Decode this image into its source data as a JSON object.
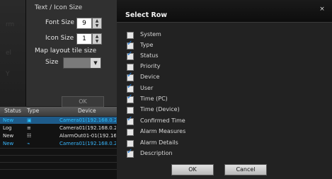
{
  "background": {
    "left_labels": [
      "rm",
      "el",
      "Y"
    ],
    "section_title": "Text / Icon Size",
    "font_size_label": "Font Size",
    "font_size_value": "9",
    "icon_size_label": "Icon Size",
    "icon_size_value": "1",
    "map_layout_label": "Map layout tile size",
    "size_label": "Size",
    "ok_label": "OK",
    "table": {
      "headers": [
        "Status",
        "Type",
        "Device"
      ],
      "rows": [
        {
          "status": "New",
          "type": "▣",
          "device": "Camera01(192.168.0.22"
        },
        {
          "status": "Log",
          "type": "≡",
          "device": "Camera01(192.168.0.22"
        },
        {
          "status": "New",
          "type": "☷",
          "device": "AlarmOut01-01(192.168."
        },
        {
          "status": "New",
          "type": "⌁",
          "device": "Camera01(192.168.0.22"
        }
      ]
    }
  },
  "dialog": {
    "title": "Select Row",
    "close_glyph": "×",
    "items": [
      {
        "label": "System",
        "checked": false
      },
      {
        "label": "Type",
        "checked": true
      },
      {
        "label": "Status",
        "checked": true
      },
      {
        "label": "Priority",
        "checked": false
      },
      {
        "label": "Device",
        "checked": true
      },
      {
        "label": "User",
        "checked": true
      },
      {
        "label": "Time (PC)",
        "checked": true
      },
      {
        "label": "Time (Device)",
        "checked": false
      },
      {
        "label": "Confirmed Time",
        "checked": true
      },
      {
        "label": "Alarm Measures",
        "checked": false
      },
      {
        "label": "Alarm Details",
        "checked": false
      },
      {
        "label": "Description",
        "checked": true
      }
    ],
    "ok_label": "OK",
    "cancel_label": "Cancel"
  }
}
